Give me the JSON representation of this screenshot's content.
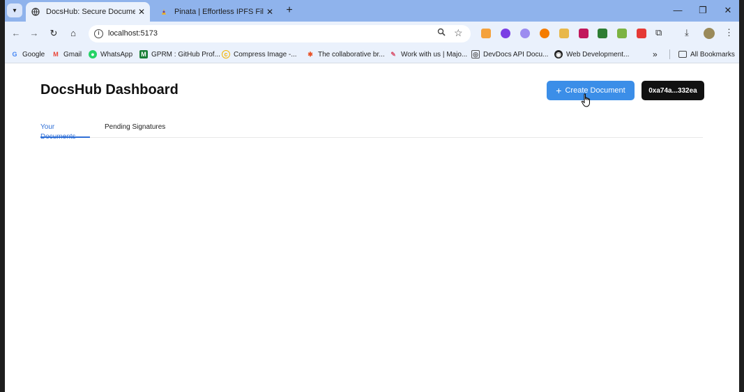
{
  "browser": {
    "tabs": [
      {
        "title": "DocsHub: Secure Document M",
        "favicon": "globe-icon",
        "active": true
      },
      {
        "title": "Pinata | Effortless IPFS File Man",
        "favicon": "pinata-icon",
        "active": false
      }
    ],
    "address": "localhost:5173",
    "bookmarks": [
      {
        "label": "Google",
        "icon": "google-icon",
        "color": "#4285f4"
      },
      {
        "label": "Gmail",
        "icon": "gmail-icon",
        "color": "#ea4335"
      },
      {
        "label": "WhatsApp",
        "icon": "whatsapp-icon",
        "color": "#25d366"
      },
      {
        "label": "GPRM : GitHub Prof...",
        "icon": "gprm-icon",
        "color": "#1a7f37"
      },
      {
        "label": "Compress Image -...",
        "icon": "compress-icon",
        "color": "#f4b400"
      },
      {
        "label": "The collaborative br...",
        "icon": "collab-icon",
        "color": "#e8542a"
      },
      {
        "label": "Work with us | Majo...",
        "icon": "major-icon",
        "color": "#d94f6a"
      },
      {
        "label": "DevDocs API Docu...",
        "icon": "devdocs-icon",
        "color": "#555555"
      },
      {
        "label": "Web Development...",
        "icon": "web-icon",
        "color": "#222222"
      }
    ],
    "all_bookmarks": "All Bookmarks"
  },
  "page": {
    "title": "DocsHub Dashboard",
    "create_button": "Create Document",
    "wallet_address": "0xa74a...332ea",
    "tabs": [
      "Your Documents",
      "Pending Signatures"
    ],
    "active_tab": "Your Documents"
  },
  "colors": {
    "accent": "#3b8ee8",
    "tab_active": "#2f6fd6"
  }
}
